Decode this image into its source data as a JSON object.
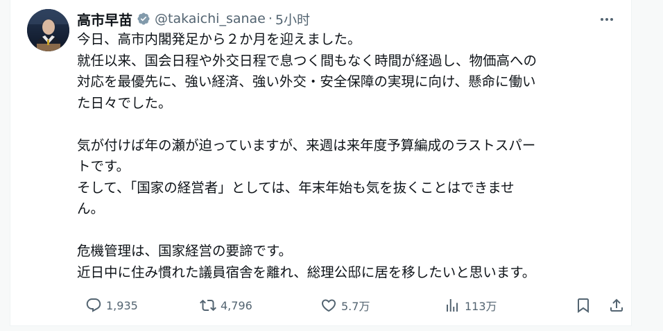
{
  "author": {
    "display_name": "高市早苗",
    "handle": "@takaichi_sanae",
    "separator": "·",
    "time": "5小时",
    "verified_color": "#829aab"
  },
  "post": {
    "paragraphs": [
      [
        "今日、高市内閣発足から２か月を迎えました。",
        "就任以来、国会日程や外交日程で息つく間もなく時間が経過し、物価高への",
        "対応を最優先に、強い経済、強い外交・安全保障の実現に向け、懸命に働い",
        "た日々でした。"
      ],
      [
        "気が付けば年の瀬が迫っていますが、来週は来年度予算編成のラストスパー",
        "トです。",
        "そして、「国家の経営者」としては、年末年始も気を抜くことはできませ",
        "ん。"
      ],
      [
        "危機管理は、国家経営の要諦です。",
        "近日中に住み慣れた議員宿舎を離れ、総理公邸に居を移したいと思います。"
      ]
    ]
  },
  "actions": {
    "reply_count": "1,935",
    "retweet_count": "4,796",
    "like_count": "5.7万",
    "views_count": "113万"
  },
  "colors": {
    "text": "#0f1419",
    "secondary": "#536471"
  }
}
